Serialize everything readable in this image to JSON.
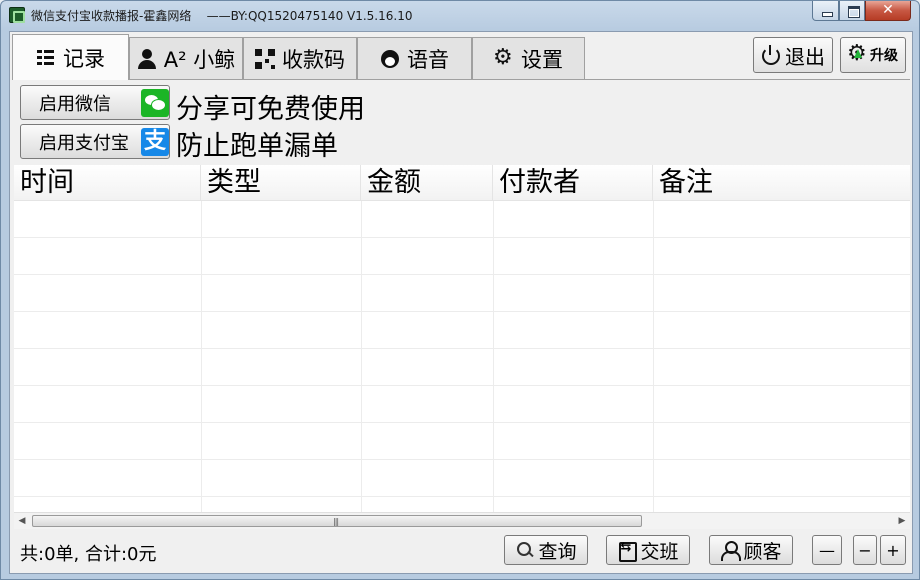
{
  "window": {
    "title": "微信支付宝收款播报-霍鑫网络",
    "subtitle": "——BY:QQ1520475140 V1.5.16.10"
  },
  "tabs": [
    {
      "label": "记录",
      "icon": "list-icon"
    },
    {
      "label": "A² 小鲸",
      "icon": "user-icon"
    },
    {
      "label": "收款码",
      "icon": "qr-code-icon"
    },
    {
      "label": "语音",
      "icon": "face-icon"
    },
    {
      "label": "设置",
      "icon": "gear-icon"
    }
  ],
  "toolbar": {
    "logout_label": "退出",
    "upgrade_label": "升级"
  },
  "enable": {
    "wechat_label": "启用微信",
    "alipay_label": "启用支付宝",
    "alipay_glyph": "支",
    "promo_line1": "分享可免费使用",
    "promo_line2": "防止跑单漏单"
  },
  "table": {
    "columns": [
      "时间",
      "类型",
      "金额",
      "付款者",
      "备注"
    ],
    "rows": []
  },
  "status": {
    "summary": "共:0单, 合计:0元"
  },
  "footer": {
    "query_label": "查询",
    "shift_label": "交班",
    "customer_label": "顾客",
    "dash_label": "—",
    "minus_label": "−",
    "plus_label": "+"
  },
  "colors": {
    "wechat_green": "#1bb526",
    "alipay_blue": "#1688e8",
    "close_red": "#c75843"
  }
}
